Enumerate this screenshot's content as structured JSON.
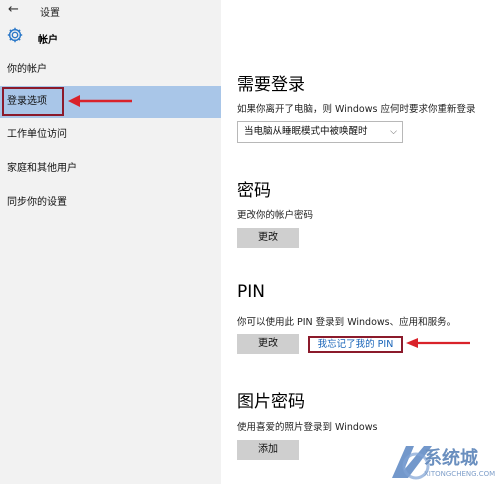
{
  "window": {
    "back_symbol": "←",
    "title": "设置"
  },
  "sidebar": {
    "header": "帐户",
    "items": [
      {
        "label": "你的帐户"
      },
      {
        "label": "登录选项"
      },
      {
        "label": "工作单位访问"
      },
      {
        "label": "家庭和其他用户"
      },
      {
        "label": "同步你的设置"
      }
    ]
  },
  "require_signin": {
    "heading": "需要登录",
    "description": "如果你离开了电脑，则 Windows 应何时要求你重新登录",
    "selected_option": "当电脑从睡眠模式中被唤醒时"
  },
  "password": {
    "heading": "密码",
    "description": "更改你的帐户密码",
    "button": "更改"
  },
  "pin": {
    "heading": "PIN",
    "description": "你可以使用此 PIN 登录到 Windows、应用和服务。",
    "button": "更改",
    "forgot_link": "我忘记了我的 PIN"
  },
  "picture_password": {
    "heading": "图片密码",
    "description": "使用喜爱的照片登录到 Windows",
    "button": "添加"
  },
  "watermark": {
    "text": "系统城",
    "sub": "XITONGCHENG.COM"
  },
  "colors": {
    "selected_bg": "#a9c6e8",
    "sidebar_bg": "#f2f2f2",
    "annotation_red": "#8b1a2b",
    "arrow_red": "#d9222a",
    "link_blue": "#1763b8",
    "button_gray": "#cfcfcf"
  },
  "icons": {
    "settings": "gear-icon",
    "back": "back-arrow-icon",
    "dropdown": "chevron-down-icon"
  }
}
